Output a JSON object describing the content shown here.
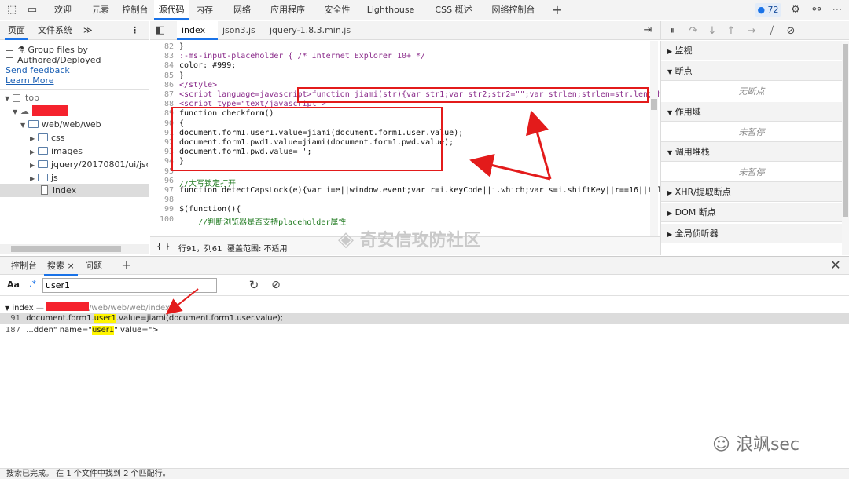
{
  "toolbar": {
    "tabs": [
      "欢迎",
      "元素",
      "控制台",
      "源代码",
      "内存",
      "网络",
      "应用程序",
      "安全性",
      "Lighthouse",
      "CSS 概述",
      "网络控制台"
    ],
    "active_tab": "源代码",
    "issues_count": "72",
    "icons": [
      "inspect-icon",
      "device-toggle-icon",
      "plus-icon",
      "gear-icon",
      "connect-icon",
      "more-icon"
    ]
  },
  "navigator": {
    "tabs": [
      "页面",
      "文件系统"
    ],
    "more": "≫",
    "menu": "⋮",
    "group_label": "Group files by Authored/Deployed",
    "send_feedback": "Send feedback",
    "learn_more": "Learn More",
    "tree": {
      "top": "top",
      "folder_path": "web/web/web",
      "css": "css",
      "images": "images",
      "jquery": "jquery/20170801/ui/json3_s",
      "js": "js",
      "index": "index"
    }
  },
  "editor": {
    "tabs": [
      "index",
      "json3.js",
      "jquery-1.8.3.min.js"
    ],
    "active_tab": "index",
    "close_glyph": "×",
    "lines": [
      {
        "n": "82",
        "text": "}"
      },
      {
        "n": "83",
        "text": ":-ms-input-placeholder { /* Internet Explorer 10+ */"
      },
      {
        "n": "84",
        "text": "color: #999;"
      },
      {
        "n": "85",
        "text": "}"
      },
      {
        "n": "86",
        "text": "</style>"
      },
      {
        "n": "87",
        "text": "<script language=javascript>function jiami(str){var str1;var str2;str2=\"\";var strlen;strlen=str.length;for"
      },
      {
        "n": "88",
        "text": "<script type=\"text/javascript\">"
      },
      {
        "n": "89",
        "text": "function checkform()"
      },
      {
        "n": "90",
        "text": "{"
      },
      {
        "n": "91",
        "text": "document.form1.user1.value=jiami(document.form1.user.value);"
      },
      {
        "n": "92",
        "text": "document.form1.pwd1.value=jiami(document.form1.pwd.value);"
      },
      {
        "n": "93",
        "text": "document.form1.pwd.value='';"
      },
      {
        "n": "94",
        "text": "}"
      },
      {
        "n": "95",
        "text": ""
      },
      {
        "n": "96",
        "text": "//大写锁定打开"
      },
      {
        "n": "97",
        "text": "function detectCapsLock(e){var i=e||window.event;var r=i.keyCode||i.which;var s=i.shiftKey||r==16||false;if("
      },
      {
        "n": "98",
        "text": ""
      },
      {
        "n": "99",
        "text": "$(function(){"
      },
      {
        "n": "100",
        "text": "    //判断浏览器是否支持placeholder属性"
      }
    ],
    "status": {
      "braces": "{ }",
      "position": "行91，列61",
      "coverage": "覆盖范围: 不适用"
    }
  },
  "debugger": {
    "sections": [
      {
        "title": "监视",
        "body": ""
      },
      {
        "title": "断点",
        "body": "无断点"
      },
      {
        "title": "作用域",
        "body": "未暂停"
      },
      {
        "title": "调用堆栈",
        "body": "未暂停"
      },
      {
        "title": "XHR/提取断点",
        "body": ""
      },
      {
        "title": "DOM 断点",
        "body": ""
      },
      {
        "title": "全局侦听器",
        "body": ""
      }
    ]
  },
  "drawer": {
    "tabs": [
      "控制台",
      "搜索",
      "问题"
    ],
    "active_tab": "搜索",
    "case_toggle": "Aa",
    "regex_toggle": ".*",
    "search_value": "user1",
    "result_file": "index",
    "result_sep": " — ",
    "result_path": "/web/web/web/index",
    "results": [
      {
        "n": "91",
        "pre": "document.form1.",
        "match": "user1",
        "post": ".value=jiami(document.form1.user.value);"
      },
      {
        "n": "187",
        "pre": "...dden\" name=\"",
        "match": "user1",
        "post": "\" value=\">"
      }
    ]
  },
  "status_bar": "搜索已完成。 在 1 个文件中找到 2 个匹配行。",
  "watermarks": {
    "center": "奇安信攻防社区",
    "bottom_right": "浪飒sec"
  },
  "colors": {
    "accent": "#1a73e8",
    "highlight": "#fff500",
    "annotation_red": "#e31b1b"
  }
}
